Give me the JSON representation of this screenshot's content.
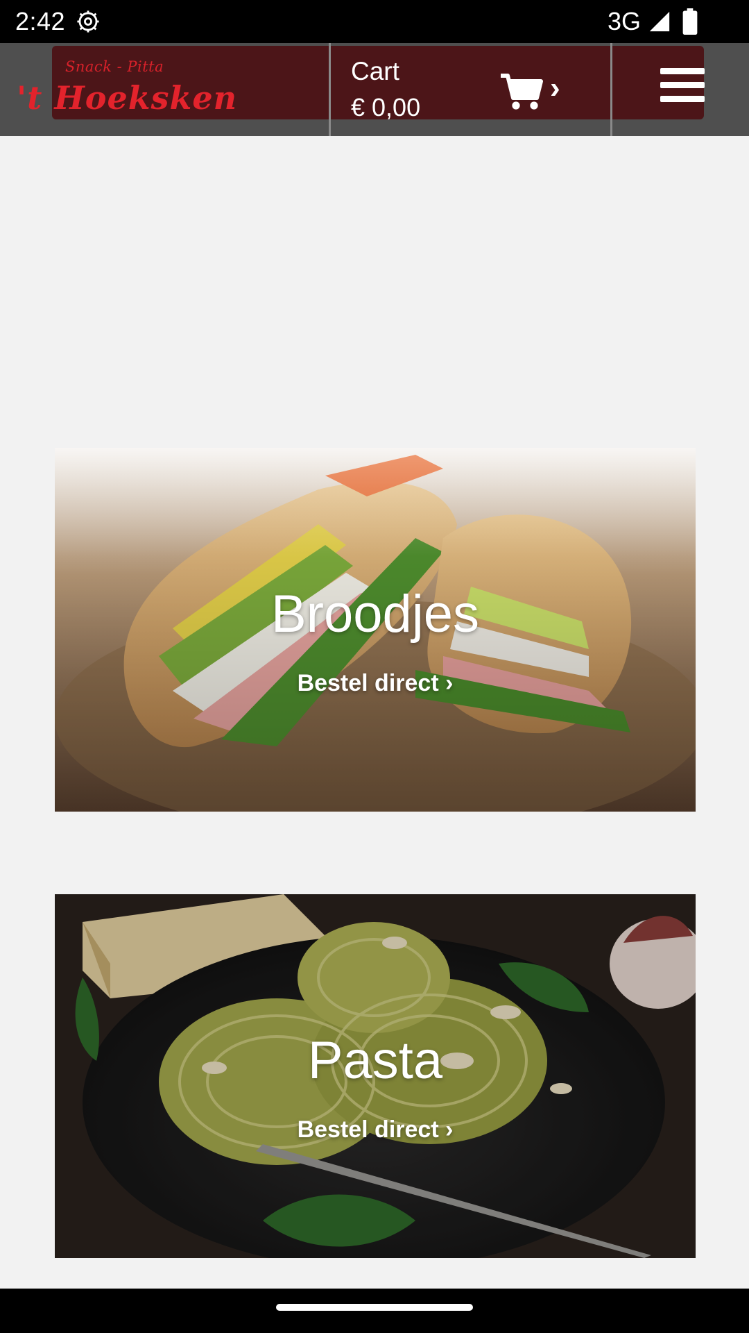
{
  "status_bar": {
    "time": "2:42",
    "network": "3G",
    "icons": [
      "settings-gear-icon",
      "signal-icon",
      "battery-icon"
    ]
  },
  "header": {
    "logo": {
      "tagline": "Snack - Pitta",
      "name": "'t Hoeksken"
    },
    "cart": {
      "title": "Cart",
      "total": "€ 0,00",
      "icon": "shopping-cart-icon",
      "chevron": "›"
    },
    "menu_icon": "hamburger-menu-icon"
  },
  "categories": [
    {
      "title": "Broodjes",
      "link": "Bestel direct ›"
    },
    {
      "title": "Pasta",
      "link": "Bestel direct ›"
    }
  ],
  "colors": {
    "header_bg": "#4f4f4f",
    "header_inner": "#4c1518",
    "logo_red": "#e3232c",
    "page_bg": "#f2f2f2"
  }
}
